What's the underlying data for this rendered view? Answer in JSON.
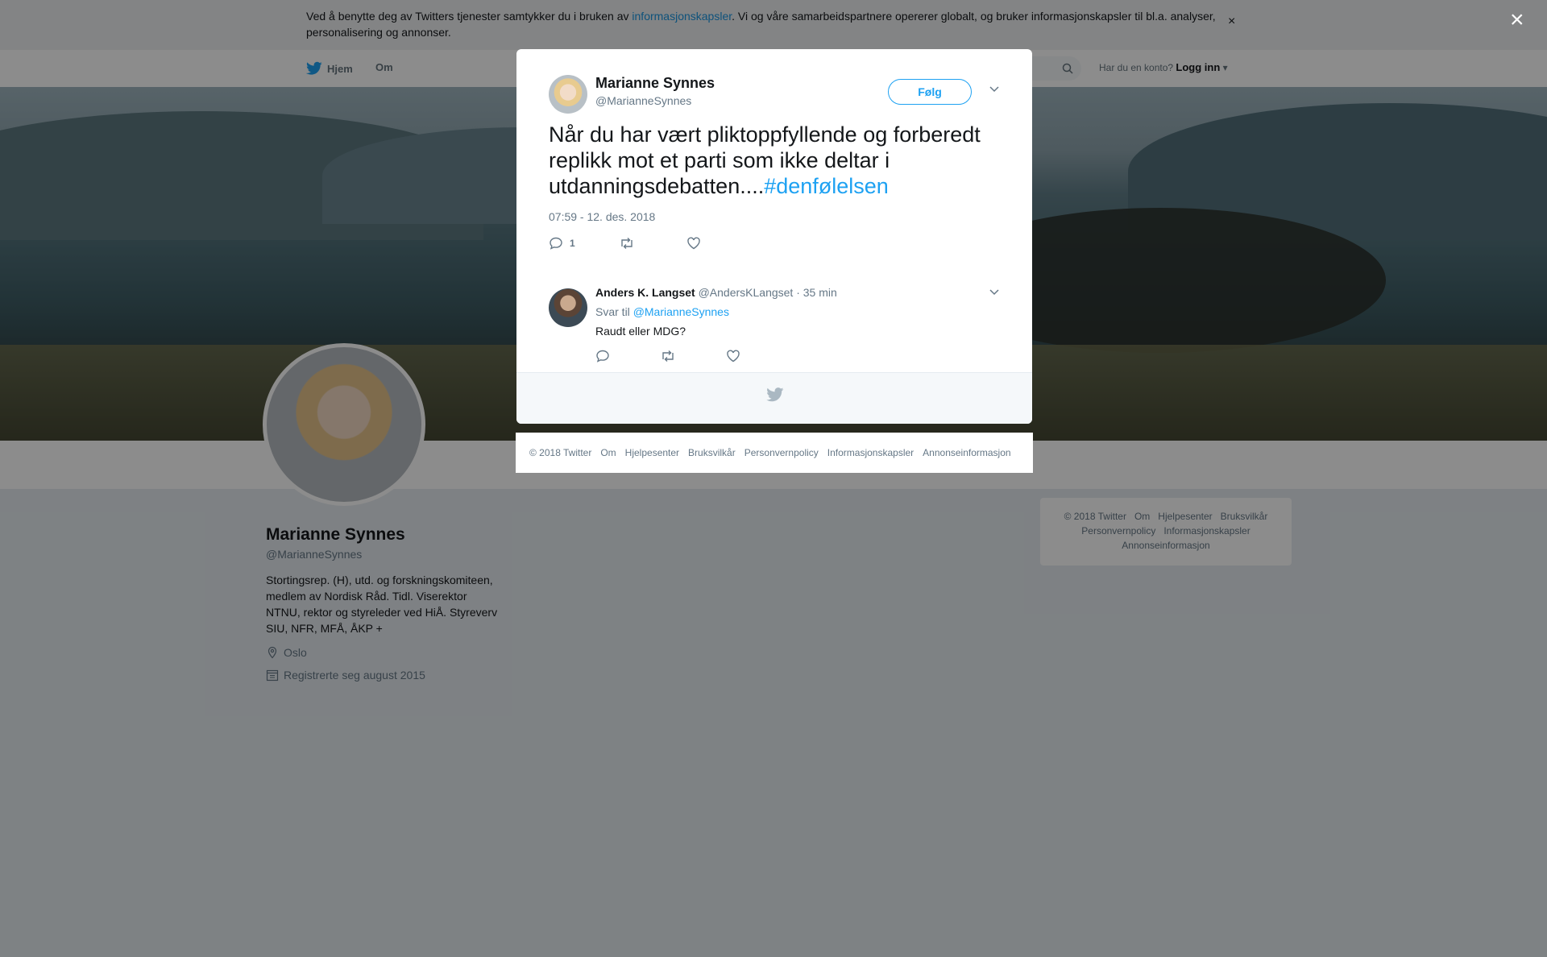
{
  "cookie_banner": {
    "text_before": "Ved å benytte deg av Twitters tjenester samtykker du i bruken av ",
    "link": "informasjonskapsler",
    "text_after": ". Vi og våre samarbeidspartnere opererer globalt, og bruker informasjonskapsler til bl.a. analyser, personalisering og annonser.",
    "close": "×"
  },
  "nav": {
    "home": "Hjem",
    "about": "Om",
    "login_prompt": "Har du en konto?",
    "login": "Logg inn"
  },
  "profile": {
    "name": "Marianne Synnes",
    "handle": "@MarianneSynnes",
    "bio": "Stortingsrep. (H), utd. og forskningskomiteen, medlem av Nordisk Råd. Tidl. Viserektor NTNU, rektor og styreleder ved HiÅ. Styreverv SIU, NFR, MFÅ, ÅKP +",
    "location": "Oslo",
    "joined": "Registrerte seg august 2015"
  },
  "side_footer": [
    "© 2018 Twitter",
    "Om",
    "Hjelpesenter",
    "Bruksvilkår",
    "Personvernpolicy",
    "Informasjonskapsler",
    "Annonseinformasjon"
  ],
  "overlay_close": "×",
  "tweet": {
    "author_name": "Marianne Synnes",
    "author_handle": "@MarianneSynnes",
    "follow_label": "Følg",
    "text": "Når du har vært pliktoppfyllende og forberedt replikk mot et parti som ikke deltar i utdanningsdebatten....",
    "hashtag": "#denfølelsen",
    "timestamp": "07:59 - 12. des. 2018",
    "reply_count": "1"
  },
  "reply": {
    "author_name": "Anders K. Langset",
    "author_handle": "@AndersKLangset",
    "time": "· 35 min",
    "reply_to_prefix": "Svar til ",
    "reply_to_handle": "@MarianneSynnes",
    "text": "Raudt eller MDG?"
  },
  "bottom_footer": [
    "© 2018 Twitter",
    "Om",
    "Hjelpesenter",
    "Bruksvilkår",
    "Personvernpolicy",
    "Informasjonskapsler",
    "Annonseinformasjon"
  ],
  "colors": {
    "accent": "#1da1f2",
    "text": "#14171a",
    "muted": "#657786"
  }
}
